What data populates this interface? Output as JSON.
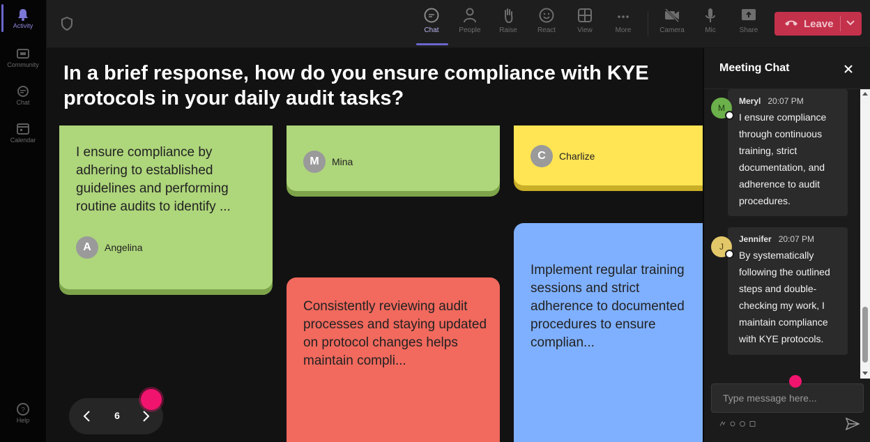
{
  "rail": {
    "items": [
      {
        "label": "Activity",
        "icon": "bell-icon"
      },
      {
        "label": "Community",
        "icon": "community-icon"
      },
      {
        "label": "Chat",
        "icon": "chat-icon"
      },
      {
        "label": "Calendar",
        "icon": "calendar-icon"
      }
    ],
    "help": {
      "label": "Help",
      "icon": "help-icon"
    }
  },
  "toolbar": {
    "items": [
      {
        "label": "Chat",
        "icon": "chat-bubble-icon"
      },
      {
        "label": "People",
        "icon": "people-icon"
      },
      {
        "label": "Raise",
        "icon": "raise-hand-icon"
      },
      {
        "label": "React",
        "icon": "smiley-icon"
      },
      {
        "label": "View",
        "icon": "grid-view-icon"
      },
      {
        "label": "More",
        "icon": "more-dots-icon"
      },
      {
        "label": "Camera",
        "icon": "camera-off-icon"
      },
      {
        "label": "Mic",
        "icon": "mic-icon"
      },
      {
        "label": "Share",
        "icon": "share-screen-icon"
      }
    ],
    "leave_label": "Leave"
  },
  "stage": {
    "question": "In a brief response, how do you ensure compliance with KYE protocols in your daily audit tasks?",
    "cards": [
      {
        "color": "green",
        "text": "I ensure compliance by adhering to established guidelines and performing routine audits to identify ...",
        "author": "Angelina",
        "initial": "A"
      },
      {
        "color": "green",
        "text": "",
        "author": "Mina",
        "initial": "M"
      },
      {
        "color": "yellow",
        "text": "",
        "author": "Charlize",
        "initial": "C"
      },
      {
        "color": "red",
        "text": "Consistently reviewing audit processes and staying updated on protocol changes helps maintain compli...",
        "author": "",
        "initial": ""
      },
      {
        "color": "blue",
        "text": "Implement regular training sessions and strict adherence to documented procedures to ensure complian...",
        "author": "",
        "initial": ""
      }
    ],
    "page": "6"
  },
  "chat": {
    "title": "Meeting Chat",
    "messages": [
      {
        "name": "Meryl",
        "initial": "M",
        "time": "20:07 PM",
        "text": "I ensure compliance through continuous training, strict documentation, and adherence to audit procedures.",
        "avatar_color": "#6bb04a"
      },
      {
        "name": "Jennifer",
        "initial": "J",
        "time": "20:07 PM",
        "text": "By systematically following the outlined steps and double-checking my work, I maintain compliance with KYE protocols.",
        "avatar_color": "#e3c86a"
      }
    ],
    "input_placeholder": "Type message here..."
  }
}
